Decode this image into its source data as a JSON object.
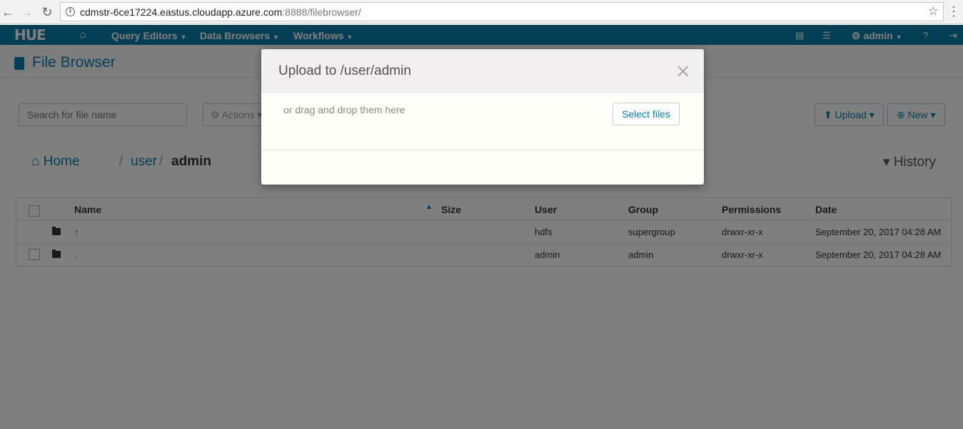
{
  "browser": {
    "url_host": "cdmstr-6ce17224.eastus.cloudapp.azure.com",
    "url_rest": ":8888/filebrowser/"
  },
  "navbar": {
    "logo": "HUE",
    "query_editors": "Query Editors",
    "data_browsers": "Data Browsers",
    "workflows": "Workflows",
    "user": "admin"
  },
  "page": {
    "title": "File Browser",
    "search_placeholder": "Search for file name",
    "actions_label": "Actions",
    "upload_label": "Upload",
    "new_label": "New",
    "history_label": "History"
  },
  "breadcrumb": {
    "home": "Home",
    "sep": "/",
    "user": "user",
    "admin": "admin"
  },
  "table": {
    "headers": {
      "name": "Name",
      "size": "Size",
      "user": "User",
      "group": "Group",
      "permissions": "Permissions",
      "date": "Date"
    },
    "rows": [
      {
        "name": "↑",
        "size": "",
        "user": "hdfs",
        "group": "supergroup",
        "permissions": "drwxr-xr-x",
        "date": "September 20, 2017 04:28 AM"
      },
      {
        "name": ".",
        "size": "",
        "user": "admin",
        "group": "admin",
        "permissions": "drwxr-xr-x",
        "date": "September 20, 2017 04:28 AM"
      }
    ]
  },
  "modal": {
    "title": "Upload to /user/admin",
    "drop_hint": "or drag and drop them here",
    "select_files": "Select files",
    "close": "×"
  }
}
